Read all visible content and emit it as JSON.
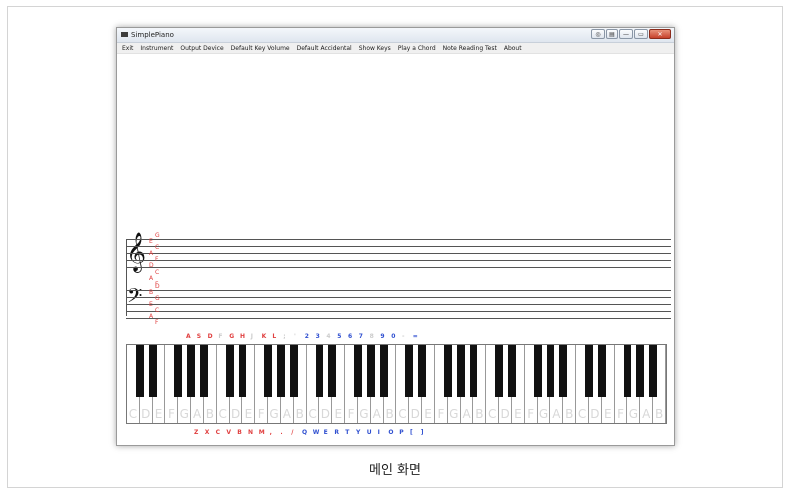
{
  "window": {
    "title": "SimplePiano",
    "buttons": [
      "◎",
      "▤",
      "—",
      "▭",
      "✕"
    ]
  },
  "menu": [
    "Exit",
    "Instrument",
    "Output Device",
    "Default Key Volume",
    "Default Accidental",
    "Show Keys",
    "Play a Chord",
    "Note Reading Test",
    "About"
  ],
  "staff": {
    "treble_clef": "𝄞",
    "bass_clef": "𝄢",
    "treble_letters": [
      "G",
      "E",
      "C",
      "A",
      "F",
      "D"
    ],
    "middle_letters": [
      "C",
      "A",
      "F"
    ],
    "bass_letters": [
      "D",
      "B",
      "G",
      "E",
      "C",
      "A",
      "F"
    ]
  },
  "keyboard": {
    "white_keys": [
      "C",
      "D",
      "E",
      "F",
      "G",
      "A",
      "B",
      "C",
      "D",
      "E",
      "F",
      "G",
      "A",
      "B",
      "C",
      "D",
      "E",
      "F",
      "G",
      "A",
      "B",
      "C",
      "D",
      "E",
      "F",
      "G",
      "A",
      "B",
      "C",
      "D",
      "E",
      "F",
      "G",
      "A",
      "B",
      "C",
      "D",
      "E",
      "F",
      "G",
      "A",
      "B"
    ],
    "black_key_pattern": [
      1,
      1,
      0,
      1,
      1,
      1,
      0
    ],
    "upper_labels": [
      "A",
      "S",
      "D",
      "F",
      "G",
      "H",
      "J",
      "K",
      "L",
      ";",
      "'",
      "2",
      "3",
      "4",
      "5",
      "6",
      "7",
      "8",
      "9",
      "0",
      "-",
      "="
    ],
    "lower_labels": [
      "Z",
      "X",
      "C",
      "V",
      "B",
      "N",
      "M",
      ",",
      ".",
      "/",
      "Q",
      "W",
      "E",
      "R",
      "T",
      "Y",
      "U",
      "I",
      "O",
      "P",
      "[",
      "]"
    ],
    "red_color": "#e04040",
    "blue_color": "#3050d0",
    "faded_color": "#cccccc"
  },
  "caption": "메인 화면"
}
